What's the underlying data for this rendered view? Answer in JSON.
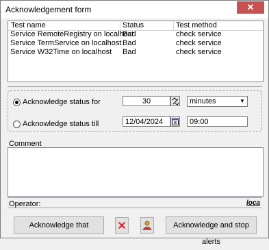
{
  "window": {
    "title": "Acknowledgement form",
    "close_glyph": "✕"
  },
  "grid": {
    "columns": [
      "Test name",
      "Status",
      "Test method"
    ],
    "rows": [
      {
        "name": "Service RemoteRegistry on localhost",
        "status": "Bad",
        "method": "check service"
      },
      {
        "name": "Service TermService on localhost",
        "status": "Bad",
        "method": "check service"
      },
      {
        "name": "Service W32Time on localhost",
        "status": "Bad",
        "method": "check service"
      }
    ]
  },
  "ack_for": {
    "label": "Acknowledge status for",
    "value": "30",
    "unit": "minutes",
    "selected": true
  },
  "ack_till": {
    "label": "Acknowledge status till",
    "date": "12/04/2024",
    "time": "09:00",
    "selected": false
  },
  "comment": {
    "label": "Comment",
    "value": ""
  },
  "operator": {
    "label": "Operator:",
    "value": "",
    "logo_text": "loca"
  },
  "buttons": {
    "ack": "Acknowledge that",
    "ack_stop": "Acknowledge and stop alerts",
    "icon_cancel": "cancel-icon",
    "icon_user": "user-alert-icon"
  }
}
